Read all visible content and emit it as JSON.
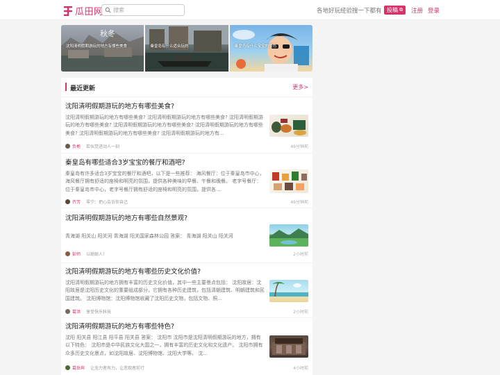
{
  "header": {
    "logo_text": "瓜田网",
    "search_placeholder": "搜索",
    "tagline": "各地好玩经验搜一下都有",
    "post_label": "投稿",
    "register_label": "注册",
    "login_label": "登录"
  },
  "banners": [
    {
      "caption": "沈阳清明假期游玩的地方有哪些美食"
    },
    {
      "caption": "秦皇岛有什么适合玩的"
    },
    {
      "caption": "秦皇岛有什么宝宝的景色"
    }
  ],
  "feed": {
    "title": "最近更新",
    "more_label": "更多>",
    "items": [
      {
        "title": "沈阳清明假期游玩的地方有哪些美食?",
        "excerpt": "沈阳清明假期游玩的地方有哪些美食? 沈阳清明假期游玩的地方有哪些美食? 沈阳清明假期游玩的地方有哪些美食? 沈阳清明假期游玩的地方有哪些美食? 沈阳清明假期游玩的地方有哪些美食? 沈阳清明假期游玩的地方有哪些美食? 沈阳清明假期游玩的地方有...",
        "author": "负桅",
        "signature": "若似觉进动人一刻",
        "time": "49分钟前",
        "avatar_color": "#6b5a4e"
      },
      {
        "title": "秦皇岛有哪些适合3岁宝宝的餐厅和酒吧?",
        "excerpt": "秦皇岛有许多适合3岁宝宝的餐厅和酒吧，以下是一些推荐： 海风餐厅：位于秦皇岛市中心，海风餐厅拥有舒适的座椅和明亮的氛围，提供各种美味的早餐、午餐和晚餐。 老字号餐厅：位于秦皇岛市中心，老字号餐厅拥有舒适的座椅和明亮的氛围，提供各...",
        "author": "齐芳",
        "signature": "零宁：把心告诉你自己",
        "time": "49分钟前",
        "avatar_color": "#5a4636"
      },
      {
        "title": "沈阳清明假期游玩的地方有哪些自然景观?",
        "excerpt": "青海湖 阳关山 阳关河 青海湖 阳关国家森林公园 答案： 青海湖 阳关山 阳关河",
        "author": "彭师",
        "signature": "以聪聪人！",
        "time": "2小时前",
        "avatar_color": "#8a5a4a"
      },
      {
        "title": "沈阳清明假期游玩的地方有哪些历史文化价值?",
        "excerpt": "沈阳清明假期游玩的地方拥有丰富的历史文化价值，其中一些主要景点包括： 沈阳故居：沈阳故居是沈阳历史文化的重要组成部分，它拥有各种历史建筑，包括清朝建筑、明朝建筑和民国建筑。 沈阳博物馆：沈阳博物馆收藏了沈阳历史文物，包括文物、照...",
        "author": "葛洪",
        "signature": "享受快乐科技",
        "time": "2小时前",
        "avatar_color": "#7a6a5a"
      },
      {
        "title": "沈阳清明假期游玩的地方有哪些特色?",
        "excerpt": "沈阳 阳关县 阳江县 阳平县 阳关县 答案： 沈阳市 沈阳市是沈阳清明假期游玩的地方，拥有以下特色： 沈阳市是中华民族文化大国之一，拥有丰富的历史文化和文化遗产。 沈阳市拥有众多历史文化景点，如沈阳故居、沈阳博物馆、沈阳大学等。 沈...",
        "author": "葛岳奔",
        "signature": "让无力者有力，让悲观者前行",
        "time": "4小时前",
        "avatar_color": "#4a6a3a"
      }
    ]
  },
  "colors": {
    "accent": "#d6336c"
  }
}
